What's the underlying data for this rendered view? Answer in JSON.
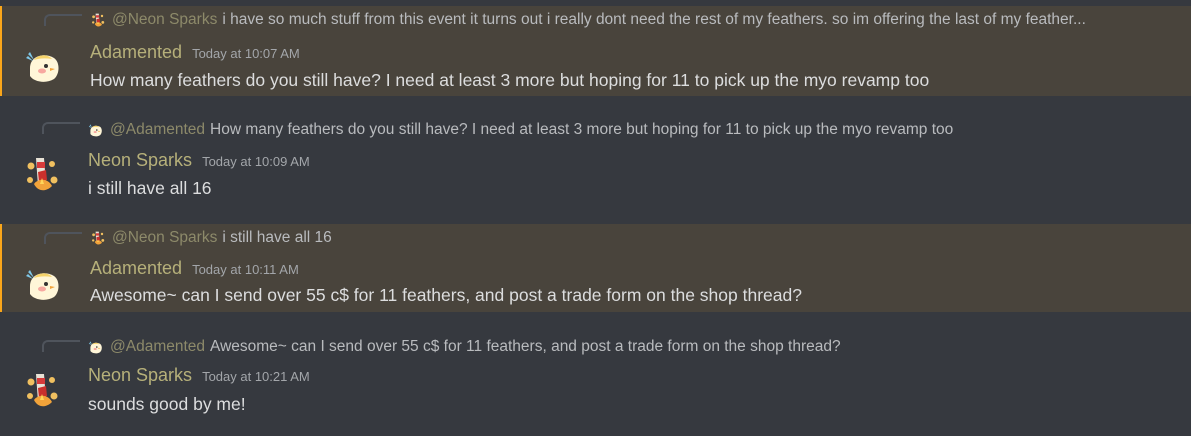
{
  "messages": [
    {
      "reply": {
        "author": "@Neon Sparks",
        "text": "i have so much stuff from this event it turns out i really dont need the rest of my feathers.  so im offering the last of my feather..."
      },
      "author": "Adamented",
      "timestamp": "Today at 10:07 AM",
      "text": "How many feathers do you still have? I need at least 3 more but hoping for 11 to pick up the myo revamp too"
    },
    {
      "reply": {
        "author": "@Adamented",
        "text": "How many feathers do you still have? I need at least 3 more but hoping for 11 to pick up the myo revamp too"
      },
      "author": "Neon Sparks",
      "timestamp": "Today at 10:09 AM",
      "text": "i still have all 16"
    },
    {
      "reply": {
        "author": "@Neon Sparks",
        "text": "i still have all 16"
      },
      "author": "Adamented",
      "timestamp": "Today at 10:11 AM",
      "text": "Awesome~ can I send over 55 c$ for 11 feathers, and post a trade form on the shop thread?"
    },
    {
      "reply": {
        "author": "@Adamented",
        "text": "Awesome~ can I send over 55 c$ for 11 feathers, and post a trade form on the shop thread?"
      },
      "author": "Neon Sparks",
      "timestamp": "Today at 10:21 AM",
      "text": "sounds good by me!"
    }
  ]
}
